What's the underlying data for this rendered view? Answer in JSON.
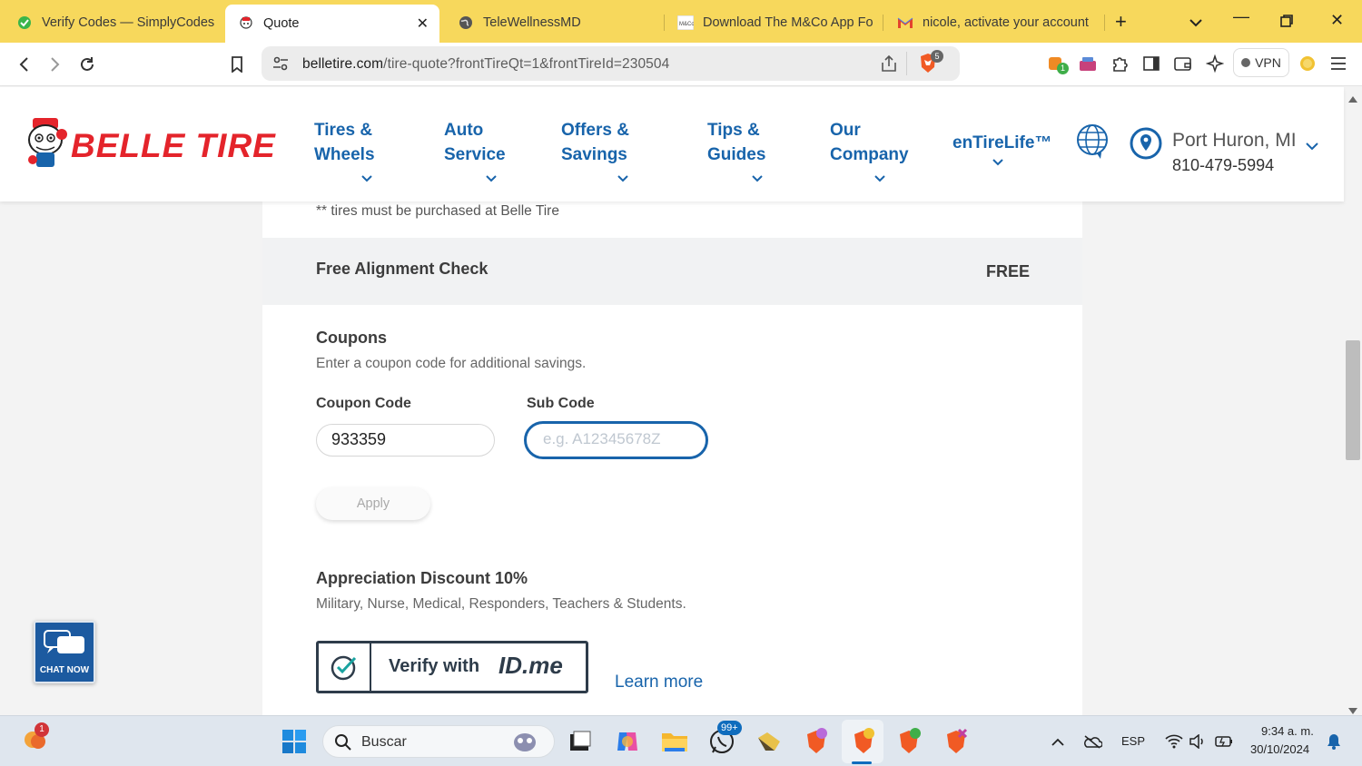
{
  "browser": {
    "tabs": [
      {
        "label": "Verify Codes — SimplyCodes",
        "icon": "simplycodes-icon"
      },
      {
        "label": "Quote",
        "icon": "belle-tire-icon",
        "active": true
      },
      {
        "label": "TeleWellnessMD",
        "icon": "globe-icon"
      },
      {
        "label": "Download The M&Co App Fo",
        "icon": "mco-icon"
      },
      {
        "label": "nicole, activate your account",
        "icon": "gmail-icon"
      }
    ],
    "url_domain": "belletire.com",
    "url_path": "/tire-quote?frontTireQt=1&frontTireId=230504",
    "brave_shield_count": "5",
    "extension_badge": "1",
    "vpn_label": "VPN"
  },
  "site": {
    "logo_text": "BELLE TIRE",
    "nav": [
      {
        "line1": "Tires &",
        "line2": "Wheels"
      },
      {
        "line1": "Auto",
        "line2": "Service"
      },
      {
        "line1": "Offers &",
        "line2": "Savings"
      },
      {
        "line1": "Tips &",
        "line2": "Guides"
      },
      {
        "line1": "Our",
        "line2": "Company"
      },
      {
        "line1": "enTireLife™",
        "line2": ""
      }
    ],
    "location_city": "Port Huron, MI",
    "location_phone": "810-479-5994",
    "brand_red": "#e4242b",
    "brand_blue": "#1864ab"
  },
  "quote": {
    "footnote": "** tires must be purchased at Belle Tire",
    "alignment_label": "Free Alignment Check",
    "alignment_price": "FREE",
    "coupons_title": "Coupons",
    "coupons_subtitle": "Enter a coupon code for additional savings.",
    "coupon_code_label": "Coupon Code",
    "coupon_code_value": "933359",
    "sub_code_label": "Sub Code",
    "sub_code_placeholder": "e.g. A12345678Z",
    "apply_label": "Apply",
    "appreciation_title": "Appreciation Discount 10%",
    "appreciation_subtitle": "Military, Nurse, Medical, Responders, Teachers & Students.",
    "verify_label": "Verify with",
    "verify_brand": "ID.me",
    "learn_more": "Learn more"
  },
  "chat": {
    "label": "CHAT NOW"
  },
  "taskbar": {
    "search_label": "Buscar",
    "whatsapp_badge": "99+",
    "notification_badge": "1",
    "language": "ESP",
    "time": "9:34 a. m.",
    "date": "30/10/2024"
  }
}
